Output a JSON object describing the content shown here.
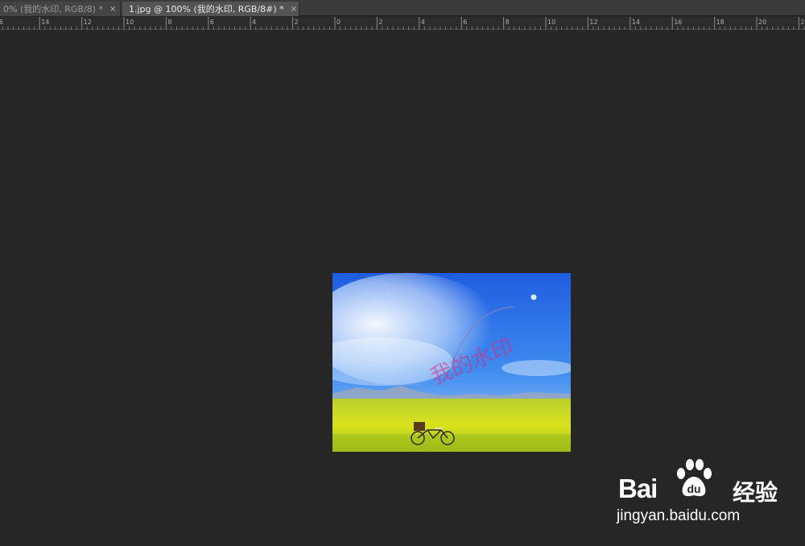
{
  "tabs": [
    {
      "label": "0% (我的水印, RGB/8) *",
      "close": "×",
      "active": false
    },
    {
      "label": "1.jpg @ 100% (我的水印, RGB/8#) *",
      "close": "×",
      "active": true
    }
  ],
  "ruler": {
    "labels": [
      "6",
      "14",
      "12",
      "10",
      "8",
      "6",
      "4",
      "2",
      "0",
      "2",
      "4",
      "6",
      "8",
      "10",
      "12",
      "14",
      "16",
      "18",
      "20",
      "2"
    ]
  },
  "document": {
    "watermark_text": "我的水印"
  },
  "logo": {
    "brand_part1": "Bai",
    "brand_part2": "",
    "product": "经验",
    "url": "jingyan.baidu.com",
    "paw_color": "#ffffff"
  }
}
